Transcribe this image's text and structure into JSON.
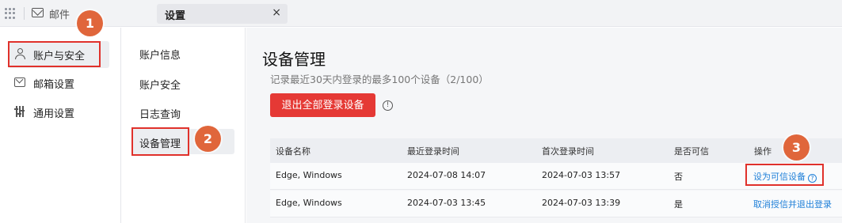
{
  "topbar": {
    "app_label": "邮件",
    "tab_label": "设置",
    "tab_close": "×"
  },
  "sidebar": {
    "items": [
      {
        "label": "账户与安全",
        "icon": "user-icon"
      },
      {
        "label": "邮箱设置",
        "icon": "mailbox-icon"
      },
      {
        "label": "通用设置",
        "icon": "sliders-icon"
      }
    ]
  },
  "subnav": {
    "items": [
      {
        "label": "账户信息"
      },
      {
        "label": "账户安全"
      },
      {
        "label": "日志查询"
      },
      {
        "label": "设备管理"
      }
    ]
  },
  "main": {
    "title": "设备管理",
    "subtitle": "记录最近30天内登录的最多100个设备（2/100）",
    "logout_all_label": "退出全部登录设备",
    "info_icon": "!",
    "table": {
      "headers": [
        "设备名称",
        "最近登录时间",
        "首次登录时间",
        "是否可信",
        "操作"
      ],
      "rows": [
        {
          "device": "Edge, Windows",
          "last_login": "2024-07-08 14:07",
          "first_login": "2024-07-03 13:57",
          "trusted": "否",
          "action": "设为可信设备",
          "action_help": "?"
        },
        {
          "device": "Edge, Windows",
          "last_login": "2024-07-03 13:45",
          "first_login": "2024-07-03 13:39",
          "trusted": "是",
          "action": "取消授信并退出登录"
        }
      ]
    }
  },
  "annotations": {
    "badges": [
      "1",
      "2",
      "3"
    ],
    "badge_color": "#e0663b",
    "highlight_color": "#e0312b"
  },
  "colors": {
    "accent_red": "#e53935",
    "link_blue": "#1e7fd8"
  }
}
